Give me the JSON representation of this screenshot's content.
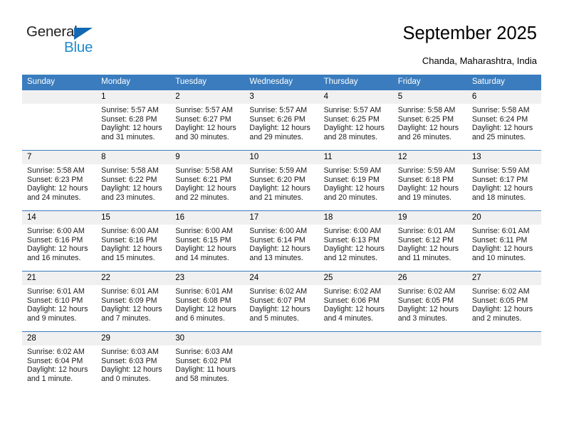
{
  "brand": {
    "name_top": "General",
    "name_bottom": "Blue",
    "triangle_color": "#1268b3",
    "blue_text_color": "#1e8bcd"
  },
  "header": {
    "title": "September 2025",
    "subtitle": "Chanda, Maharashtra, India"
  },
  "theme": {
    "header_bg": "#3a7cbe",
    "header_text": "#ffffff",
    "daynum_bg": "#f0f0f0",
    "row_border": "#3a7cbe"
  },
  "weekdays": [
    "Sunday",
    "Monday",
    "Tuesday",
    "Wednesday",
    "Thursday",
    "Friday",
    "Saturday"
  ],
  "labels": {
    "sunrise": "Sunrise:",
    "sunset": "Sunset:",
    "daylight": "Daylight:"
  },
  "weeks": [
    [
      {
        "day": "",
        "sunrise": "",
        "sunset": "",
        "daylight": "",
        "empty": true
      },
      {
        "day": "1",
        "sunrise": "Sunrise: 5:57 AM",
        "sunset": "Sunset: 6:28 PM",
        "daylight": "Daylight: 12 hours and 31 minutes."
      },
      {
        "day": "2",
        "sunrise": "Sunrise: 5:57 AM",
        "sunset": "Sunset: 6:27 PM",
        "daylight": "Daylight: 12 hours and 30 minutes."
      },
      {
        "day": "3",
        "sunrise": "Sunrise: 5:57 AM",
        "sunset": "Sunset: 6:26 PM",
        "daylight": "Daylight: 12 hours and 29 minutes."
      },
      {
        "day": "4",
        "sunrise": "Sunrise: 5:57 AM",
        "sunset": "Sunset: 6:25 PM",
        "daylight": "Daylight: 12 hours and 28 minutes."
      },
      {
        "day": "5",
        "sunrise": "Sunrise: 5:58 AM",
        "sunset": "Sunset: 6:25 PM",
        "daylight": "Daylight: 12 hours and 26 minutes."
      },
      {
        "day": "6",
        "sunrise": "Sunrise: 5:58 AM",
        "sunset": "Sunset: 6:24 PM",
        "daylight": "Daylight: 12 hours and 25 minutes."
      }
    ],
    [
      {
        "day": "7",
        "sunrise": "Sunrise: 5:58 AM",
        "sunset": "Sunset: 6:23 PM",
        "daylight": "Daylight: 12 hours and 24 minutes."
      },
      {
        "day": "8",
        "sunrise": "Sunrise: 5:58 AM",
        "sunset": "Sunset: 6:22 PM",
        "daylight": "Daylight: 12 hours and 23 minutes."
      },
      {
        "day": "9",
        "sunrise": "Sunrise: 5:58 AM",
        "sunset": "Sunset: 6:21 PM",
        "daylight": "Daylight: 12 hours and 22 minutes."
      },
      {
        "day": "10",
        "sunrise": "Sunrise: 5:59 AM",
        "sunset": "Sunset: 6:20 PM",
        "daylight": "Daylight: 12 hours and 21 minutes."
      },
      {
        "day": "11",
        "sunrise": "Sunrise: 5:59 AM",
        "sunset": "Sunset: 6:19 PM",
        "daylight": "Daylight: 12 hours and 20 minutes."
      },
      {
        "day": "12",
        "sunrise": "Sunrise: 5:59 AM",
        "sunset": "Sunset: 6:18 PM",
        "daylight": "Daylight: 12 hours and 19 minutes."
      },
      {
        "day": "13",
        "sunrise": "Sunrise: 5:59 AM",
        "sunset": "Sunset: 6:17 PM",
        "daylight": "Daylight: 12 hours and 18 minutes."
      }
    ],
    [
      {
        "day": "14",
        "sunrise": "Sunrise: 6:00 AM",
        "sunset": "Sunset: 6:16 PM",
        "daylight": "Daylight: 12 hours and 16 minutes."
      },
      {
        "day": "15",
        "sunrise": "Sunrise: 6:00 AM",
        "sunset": "Sunset: 6:16 PM",
        "daylight": "Daylight: 12 hours and 15 minutes."
      },
      {
        "day": "16",
        "sunrise": "Sunrise: 6:00 AM",
        "sunset": "Sunset: 6:15 PM",
        "daylight": "Daylight: 12 hours and 14 minutes."
      },
      {
        "day": "17",
        "sunrise": "Sunrise: 6:00 AM",
        "sunset": "Sunset: 6:14 PM",
        "daylight": "Daylight: 12 hours and 13 minutes."
      },
      {
        "day": "18",
        "sunrise": "Sunrise: 6:00 AM",
        "sunset": "Sunset: 6:13 PM",
        "daylight": "Daylight: 12 hours and 12 minutes."
      },
      {
        "day": "19",
        "sunrise": "Sunrise: 6:01 AM",
        "sunset": "Sunset: 6:12 PM",
        "daylight": "Daylight: 12 hours and 11 minutes."
      },
      {
        "day": "20",
        "sunrise": "Sunrise: 6:01 AM",
        "sunset": "Sunset: 6:11 PM",
        "daylight": "Daylight: 12 hours and 10 minutes."
      }
    ],
    [
      {
        "day": "21",
        "sunrise": "Sunrise: 6:01 AM",
        "sunset": "Sunset: 6:10 PM",
        "daylight": "Daylight: 12 hours and 9 minutes."
      },
      {
        "day": "22",
        "sunrise": "Sunrise: 6:01 AM",
        "sunset": "Sunset: 6:09 PM",
        "daylight": "Daylight: 12 hours and 7 minutes."
      },
      {
        "day": "23",
        "sunrise": "Sunrise: 6:01 AM",
        "sunset": "Sunset: 6:08 PM",
        "daylight": "Daylight: 12 hours and 6 minutes."
      },
      {
        "day": "24",
        "sunrise": "Sunrise: 6:02 AM",
        "sunset": "Sunset: 6:07 PM",
        "daylight": "Daylight: 12 hours and 5 minutes."
      },
      {
        "day": "25",
        "sunrise": "Sunrise: 6:02 AM",
        "sunset": "Sunset: 6:06 PM",
        "daylight": "Daylight: 12 hours and 4 minutes."
      },
      {
        "day": "26",
        "sunrise": "Sunrise: 6:02 AM",
        "sunset": "Sunset: 6:05 PM",
        "daylight": "Daylight: 12 hours and 3 minutes."
      },
      {
        "day": "27",
        "sunrise": "Sunrise: 6:02 AM",
        "sunset": "Sunset: 6:05 PM",
        "daylight": "Daylight: 12 hours and 2 minutes."
      }
    ],
    [
      {
        "day": "28",
        "sunrise": "Sunrise: 6:02 AM",
        "sunset": "Sunset: 6:04 PM",
        "daylight": "Daylight: 12 hours and 1 minute."
      },
      {
        "day": "29",
        "sunrise": "Sunrise: 6:03 AM",
        "sunset": "Sunset: 6:03 PM",
        "daylight": "Daylight: 12 hours and 0 minutes."
      },
      {
        "day": "30",
        "sunrise": "Sunrise: 6:03 AM",
        "sunset": "Sunset: 6:02 PM",
        "daylight": "Daylight: 11 hours and 58 minutes."
      },
      {
        "day": "",
        "sunrise": "",
        "sunset": "",
        "daylight": "",
        "empty": true
      },
      {
        "day": "",
        "sunrise": "",
        "sunset": "",
        "daylight": "",
        "empty": true
      },
      {
        "day": "",
        "sunrise": "",
        "sunset": "",
        "daylight": "",
        "empty": true
      },
      {
        "day": "",
        "sunrise": "",
        "sunset": "",
        "daylight": "",
        "empty": true
      }
    ]
  ]
}
